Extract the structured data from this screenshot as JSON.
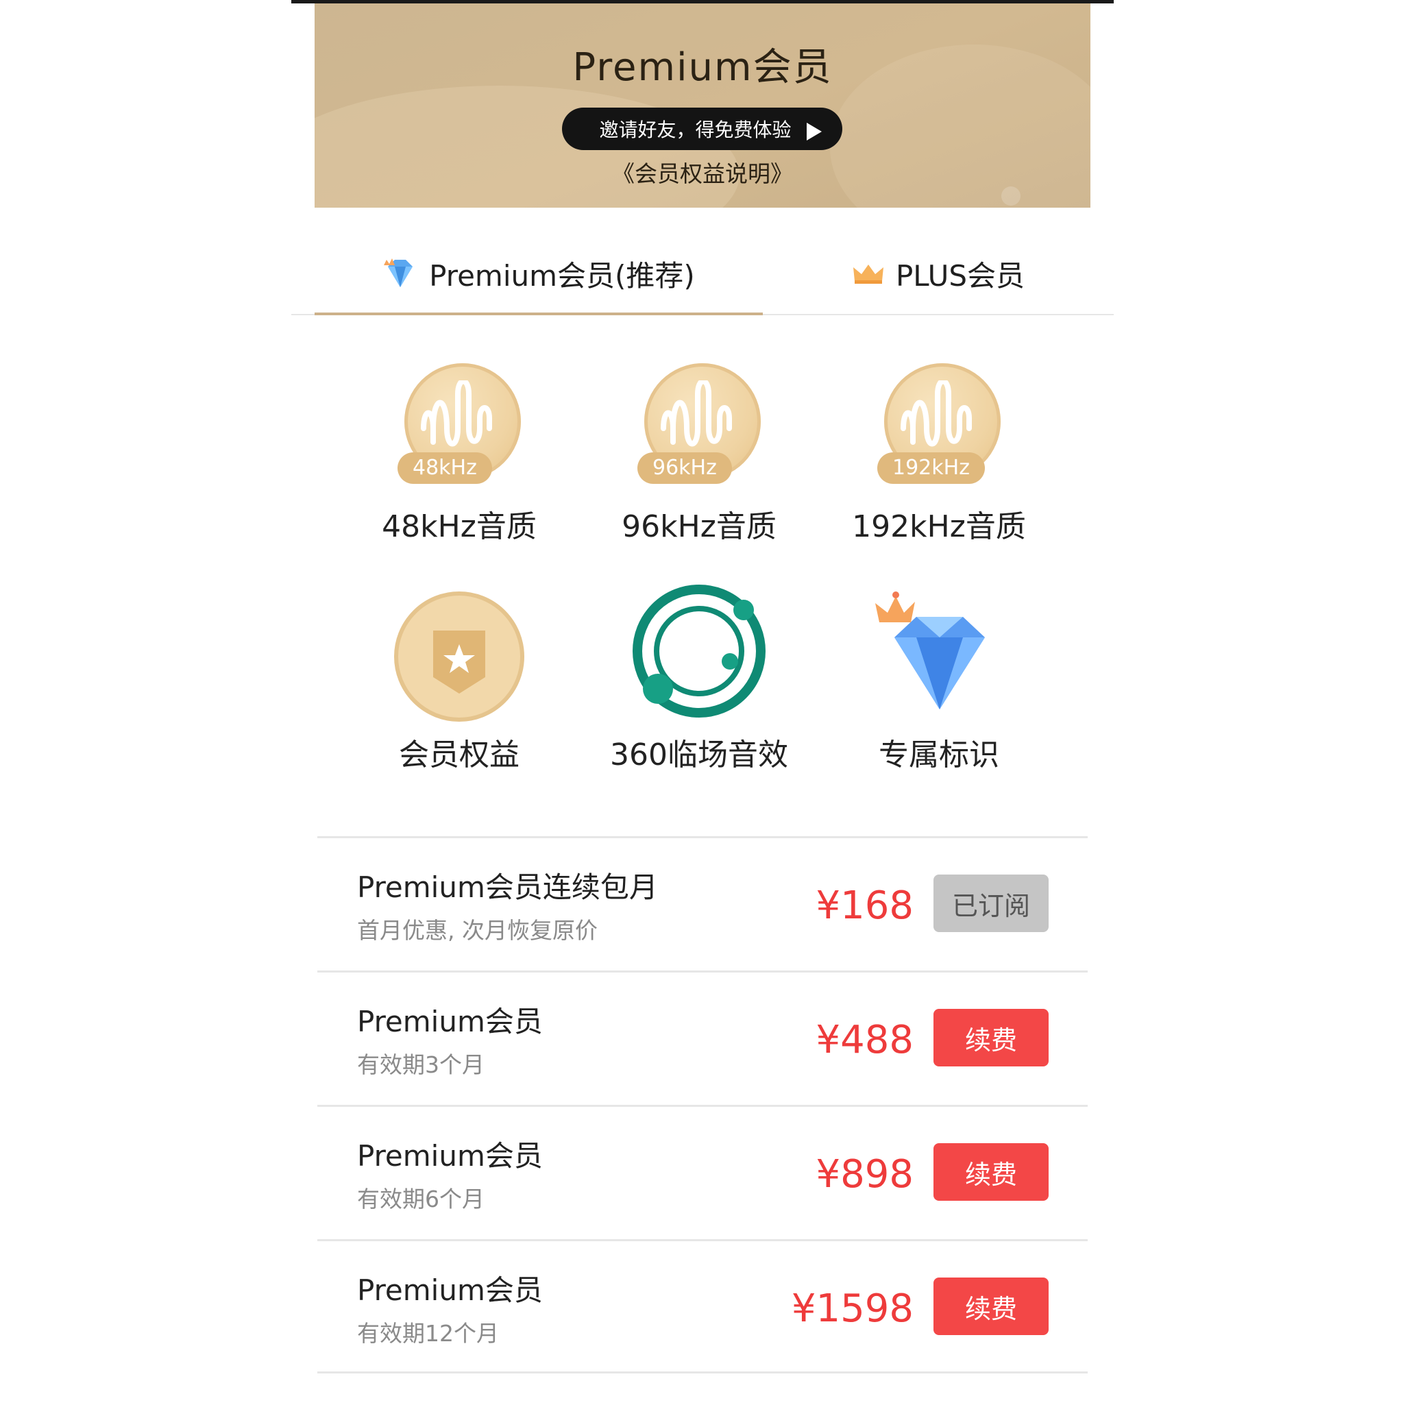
{
  "banner": {
    "title": "Premium会员",
    "invite_label": "邀请好友，得免费体验",
    "rights_link": "《会员权益说明》"
  },
  "tabs": [
    {
      "label": "Premium会员(推荐)",
      "icon": "diamond-icon",
      "active": true
    },
    {
      "label": "PLUS会员",
      "icon": "crown-icon",
      "active": false
    }
  ],
  "benefits": [
    {
      "freq": "48kHz",
      "label": "48kHz音质",
      "icon": "sound-wave-badge-icon"
    },
    {
      "freq": "96kHz",
      "label": "96kHz音质",
      "icon": "sound-wave-badge-icon"
    },
    {
      "freq": "192kHz",
      "label": "192kHz音质",
      "icon": "sound-wave-badge-icon"
    },
    {
      "label": "会员权益",
      "icon": "star-shield-badge-icon"
    },
    {
      "label": "360临场音效",
      "icon": "orbit-icon"
    },
    {
      "label": "专属标识",
      "icon": "crowned-diamond-icon"
    }
  ],
  "plans": [
    {
      "name": "Premium会员连续包月",
      "desc": "首月优惠, 次月恢复原价",
      "price": "¥168",
      "button": "已订阅",
      "subscribed": true
    },
    {
      "name": "Premium会员",
      "desc": "有效期3个月",
      "price": "¥488",
      "button": "续费",
      "subscribed": false
    },
    {
      "name": "Premium会员",
      "desc": "有效期6个月",
      "price": "¥898",
      "button": "续费",
      "subscribed": false
    },
    {
      "name": "Premium会员",
      "desc": "有效期12个月",
      "price": "¥1598",
      "button": "续费",
      "subscribed": false
    }
  ],
  "colors": {
    "banner_bg": "#d0b891",
    "accent_gold": "#cdb18a",
    "price_red": "#ee3b3b",
    "button_red": "#f34747",
    "button_disabled": "#c5c5c5"
  }
}
